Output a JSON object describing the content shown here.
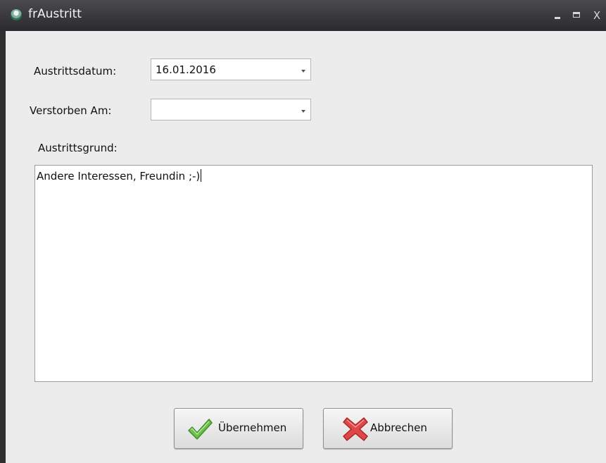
{
  "window": {
    "title": "frAustritt",
    "icons": {
      "app": "app-icon",
      "minimize": "minimize-icon",
      "maximize": "maximize-icon",
      "close": "close-icon"
    },
    "close_glyph": "X"
  },
  "form": {
    "austrittsdatum_label": "Austrittsdatum:",
    "austrittsdatum_value": "16.01.2016",
    "verstorben_label": "Verstorben Am:",
    "verstorben_value": "",
    "austrittsgrund_label": "Austrittsgrund:",
    "austrittsgrund_text": "Andere Interessen, Freundin ;-)"
  },
  "buttons": {
    "save_label": "Übernehmen",
    "save_icon": "check-icon",
    "cancel_label": "Abbrechen",
    "cancel_icon": "x-icon"
  },
  "colors": {
    "titlebar": "#2b2b2d",
    "window_bg": "#ececec",
    "check_green": "#5cb85c",
    "cancel_red": "#d9534f"
  }
}
